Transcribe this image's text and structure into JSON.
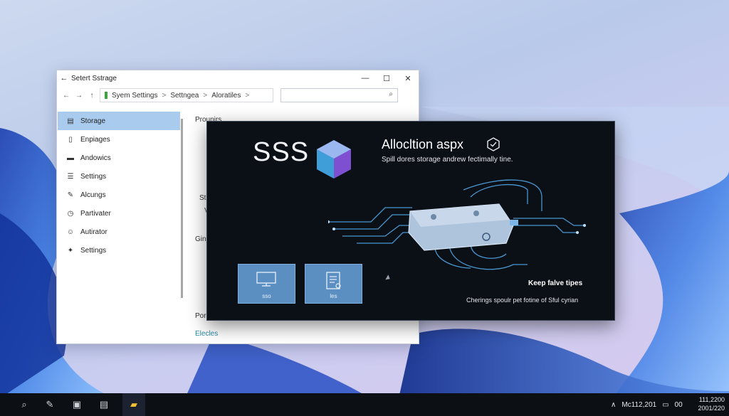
{
  "window": {
    "title": "Setert Sstrage",
    "controls": {
      "minimize": "—",
      "maximize": "☐",
      "close": "✕"
    },
    "nav": {
      "back": "←",
      "forward": "→",
      "up": "↑"
    },
    "breadcrumb": [
      "Syem Settings",
      "Settngea",
      "Aloratiles"
    ],
    "breadcrumb_sep": ">",
    "search_placeholder": ""
  },
  "sidebar": {
    "items": [
      {
        "label": "Storage",
        "icon": "storage-icon",
        "glyph": "▤",
        "active": true
      },
      {
        "label": "Enpiages",
        "icon": "document-icon",
        "glyph": "▯",
        "active": false
      },
      {
        "label": "Andowics",
        "icon": "drive-icon",
        "glyph": "▬",
        "active": false
      },
      {
        "label": "Settings",
        "icon": "list-icon",
        "glyph": "☰",
        "active": false
      },
      {
        "label": "Alcungs",
        "icon": "edit-icon",
        "glyph": "✎",
        "active": false
      },
      {
        "label": "Partivater",
        "icon": "clock-icon",
        "glyph": "◷",
        "active": false
      },
      {
        "label": "Autirator",
        "icon": "person-icon",
        "glyph": "☺",
        "active": false
      },
      {
        "label": "Settings",
        "icon": "wrench-icon",
        "glyph": "✦",
        "active": false
      }
    ]
  },
  "main": {
    "header": "Prounirs",
    "fragments": [
      "St",
      "V",
      "Gin",
      "Por",
      "Elecles"
    ]
  },
  "overlay": {
    "logo": "SSS",
    "title": "Allocltion aspx",
    "subtitle": "Spill dores storage andrew fectimally tine.",
    "tiles": [
      {
        "label": "sso",
        "icon": "monitor-icon"
      },
      {
        "label": "les",
        "icon": "file-icon"
      }
    ],
    "callout": "Keep falve tipes",
    "caption": "Cherings spoulr pet fotine of Sful cyrian"
  },
  "taskbar": {
    "tray_text": "Mc112,201",
    "tray_lang": "00",
    "clock_line1": "111,2200",
    "clock_line2": "2001/220"
  },
  "colors": {
    "accent": "#a9ccee",
    "overlay_bg": "#0b0f16",
    "tile_bg": "#5b8ec1",
    "circuit": "#4fa6e6"
  }
}
